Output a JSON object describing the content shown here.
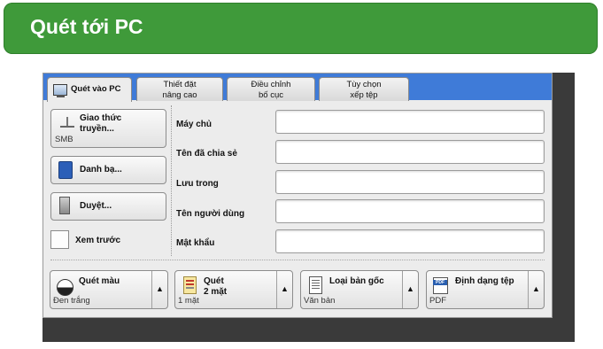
{
  "banner": {
    "title": "Quét tới PC"
  },
  "tabs": [
    {
      "label": "Quét vào PC"
    },
    {
      "line1": "Thiết đặt",
      "line2": "nâng cao"
    },
    {
      "line1": "Điều chỉnh",
      "line2": "bố cục"
    },
    {
      "line1": "Tùy chọn",
      "line2": "xếp tệp"
    }
  ],
  "left": {
    "protocol": {
      "line1": "Giao thức",
      "line2": "truyền...",
      "value": "SMB"
    },
    "address_book": "Danh bạ...",
    "browse": "Duyệt...",
    "preview": "Xem trước"
  },
  "fields": [
    {
      "label": "Máy chủ",
      "value": ""
    },
    {
      "label": "Tên đã chia sẻ",
      "value": ""
    },
    {
      "label": "Lưu trong",
      "value": ""
    },
    {
      "label": "Tên người dùng",
      "value": ""
    },
    {
      "label": "Mật khẩu",
      "value": ""
    }
  ],
  "options": [
    {
      "label": "Quét màu",
      "value": "Đen trắng"
    },
    {
      "line1": "Quét",
      "line2": "2 mặt",
      "value": "1 mặt"
    },
    {
      "label": "Loại bản gốc",
      "value": "Văn bản"
    },
    {
      "label": "Định dạng tệp",
      "value": "PDF"
    }
  ],
  "arrow_glyph": "▲",
  "colors": {
    "banner": "#3f9a3a",
    "tab_strip": "#3f7bd8"
  }
}
